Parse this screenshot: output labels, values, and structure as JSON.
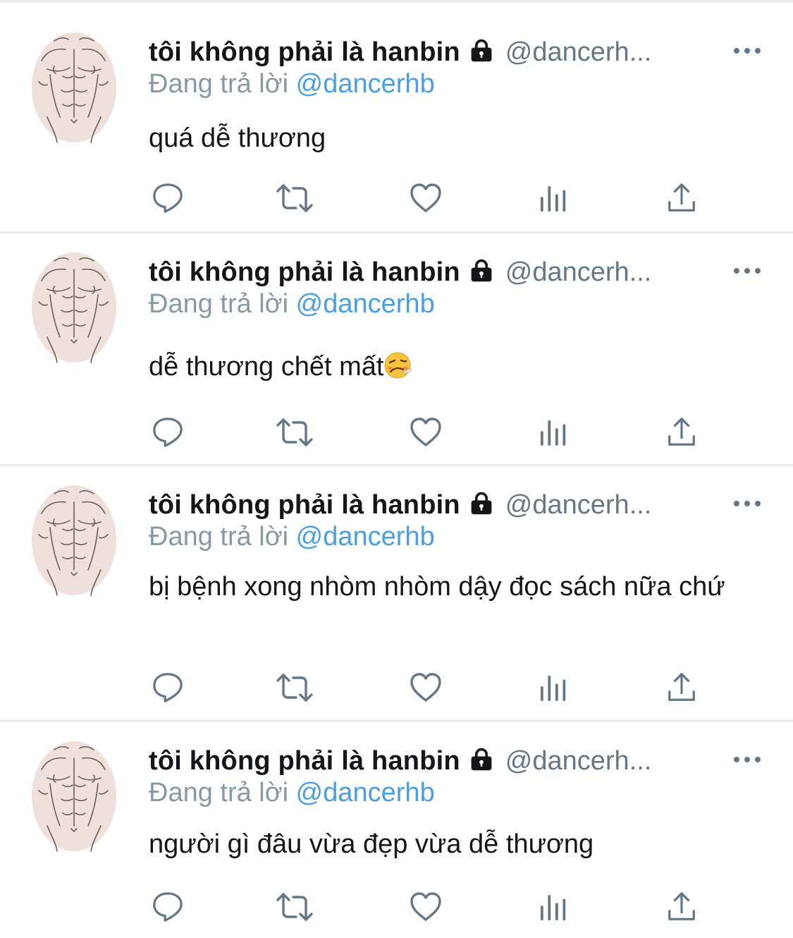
{
  "tweets": [
    {
      "author_name": "tôi không phải là hanbin",
      "handle": "@dancerh...",
      "reply_prefix": "Đang trả lời",
      "reply_to": "@dancerhb",
      "text": "quá dễ thương"
    },
    {
      "author_name": "tôi không phải là hanbin",
      "handle": "@dancerh...",
      "reply_prefix": "Đang trả lời",
      "reply_to": "@dancerhb",
      "text": "dễ thương chết mất",
      "emoji": "woozy-face-emoji"
    },
    {
      "author_name": "tôi không phải là hanbin",
      "handle": "@dancerh...",
      "reply_prefix": "Đang trả lời",
      "reply_to": "@dancerhb",
      "text": "bị bệnh xong nhòm nhòm dậy đọc sách nữa chứ"
    },
    {
      "author_name": "tôi không phải là hanbin",
      "handle": "@dancerh...",
      "reply_prefix": "Đang trả lời",
      "reply_to": "@dancerhb",
      "text": "người gì đâu vừa đẹp vừa dễ thương"
    }
  ],
  "icons": {
    "lock": "lock-icon",
    "more": "more-options-icon",
    "reply": "reply-icon",
    "retweet": "retweet-icon",
    "like": "like-icon",
    "analytics": "analytics-icon",
    "share": "share-icon"
  },
  "colors": {
    "name": "#14171a",
    "handle": "#657786",
    "reply_prefix": "#8899a6",
    "mention": "#4a9ee3",
    "icon": "#657786",
    "separator": "#e6ecf0"
  }
}
